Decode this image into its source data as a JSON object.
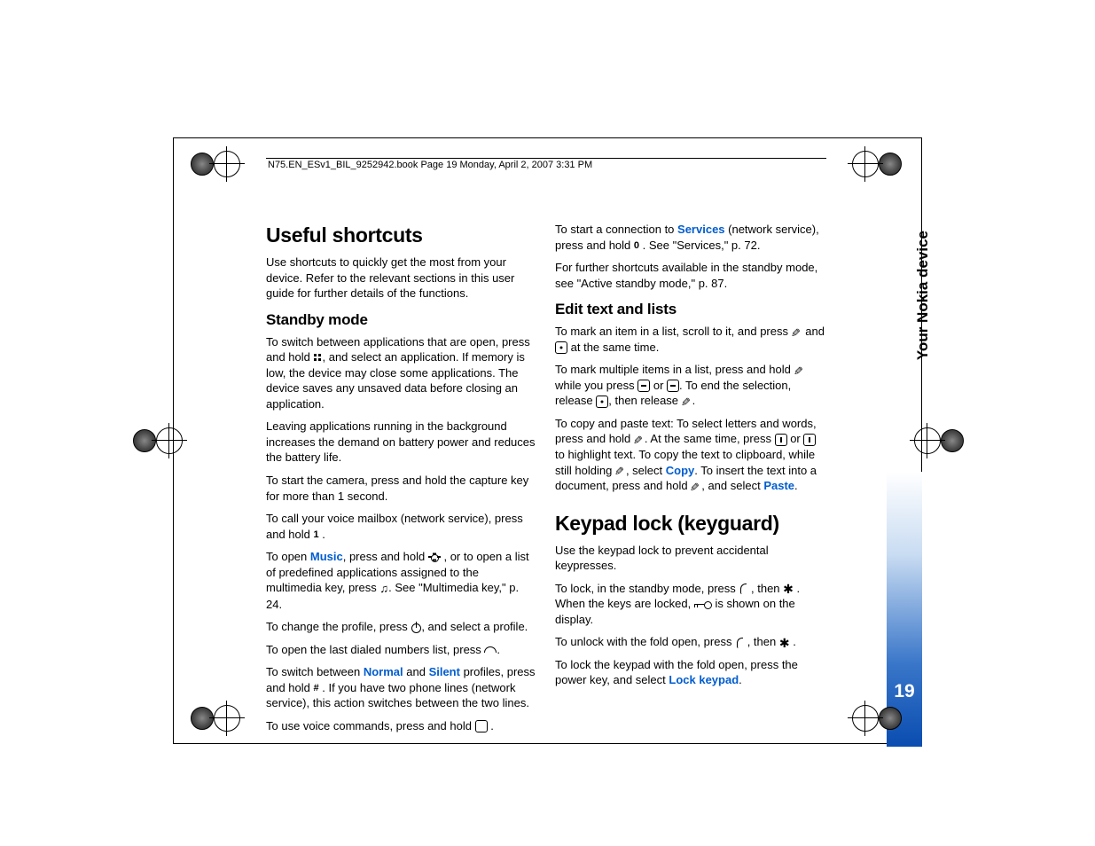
{
  "header": "N75.EN_ESv1_BIL_9252942.book  Page 19  Monday, April 2, 2007  3:31 PM",
  "side_label": "Your Nokia device",
  "page_number": "19",
  "col1": {
    "h1": "Useful shortcuts",
    "intro": "Use shortcuts to quickly get the most from your device. Refer to the relevant sections in this user guide for further details of the functions.",
    "h2": "Standby mode",
    "p1a": "To switch between applications that are open, press and hold ",
    "p1b": ", and select an application. If memory is low, the device may close some applications. The device saves any unsaved data before closing an application.",
    "p2": "Leaving applications running in the background increases the demand on battery power and reduces the battery life.",
    "p3": "To start the camera, press and hold the capture key for more than 1 second.",
    "p4a": "To call your voice mailbox (network service), press and hold ",
    "p4_key": "1",
    "p4b": ".",
    "p5a": "To open ",
    "p5_link": "Music",
    "p5b": ", press and hold ",
    "p5c": ", or to open a list of predefined applications assigned to the multimedia key, press ",
    "p5d": ". See \"Multimedia key,\" p. 24.",
    "p6a": "To change the profile, press ",
    "p6b": ", and select a profile.",
    "p7a": "To open the last dialed numbers list, press ",
    "p7b": ".",
    "p8a": "To switch between ",
    "p8_link1": "Normal",
    "p8b": " and ",
    "p8_link2": "Silent",
    "p8c": " profiles, press and hold ",
    "p8_key": "#",
    "p8d": ". If you have two phone lines (network service), this action switches between the two lines.",
    "p9a": "To use voice commands, press and hold ",
    "p9b": "."
  },
  "col2": {
    "p1a": "To start a connection to ",
    "p1_link": "Services",
    "p1b": " (network service), press and hold ",
    "p1_key": "0",
    "p1c": ". See \"Services,\" p. 72.",
    "p2": "For further shortcuts available in the standby mode, see \"Active standby mode,\" p. 87.",
    "h2": "Edit text and lists",
    "p3a": "To mark an item in a list, scroll to it, and press ",
    "p3b": " and ",
    "p3c": " at the same time.",
    "p4a": "To mark multiple items in a list, press and hold ",
    "p4b": " while you press ",
    "p4c": " or ",
    "p4d": ". To end the selection, release ",
    "p4e": ", then release ",
    "p4f": ".",
    "p5a": "To copy and paste text: To select letters and words, press and hold ",
    "p5b": ". At the same time, press ",
    "p5c": " or ",
    "p5d": " to highlight text. To copy the text to clipboard, while still holding ",
    "p5e": ", select ",
    "p5_link1": "Copy",
    "p5f": ". To insert the text into a document, press and hold ",
    "p5g": ", and select ",
    "p5_link2": "Paste",
    "p5h": ".",
    "h1": "Keypad lock (keyguard)",
    "p6": "Use the keypad lock to prevent accidental keypresses.",
    "p7a": "To lock, in the standby mode, press ",
    "p7b": ", then ",
    "p7c": ". When the keys are locked, ",
    "p7d": " is shown on the display.",
    "p8a": "To unlock with the fold open, press ",
    "p8b": ", then ",
    "p8c": ".",
    "p9a": "To lock the keypad with the fold open, press the power key, and select ",
    "p9_link": "Lock keypad",
    "p9b": "."
  }
}
